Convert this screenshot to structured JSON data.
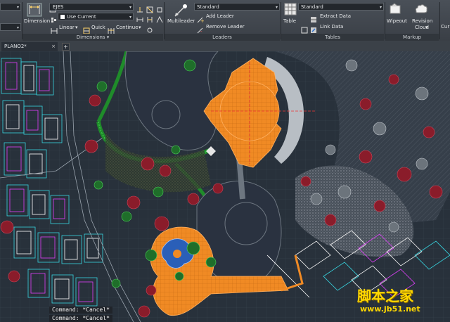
{
  "ribbon": {
    "dimension": {
      "label": "Dimension",
      "style_value": "EJES",
      "layer_value": "Use Current",
      "linear": "Linear",
      "quick": "Quick",
      "continue": "Continue",
      "panel_title": "Dimensions ▾"
    },
    "leaders": {
      "multileader": "Multileader",
      "style_value": "Standard",
      "add_leader": "Add Leader",
      "remove_leader": "Remove Leader",
      "panel_title": "Leaders"
    },
    "tables": {
      "table": "Table",
      "style_value": "Standard",
      "extract_data": "Extract Data",
      "link_data": "Link Data",
      "panel_title": "Tables"
    },
    "markup": {
      "wipeout": "Wipeout",
      "revision_cloud": "Revision\nCloud",
      "revision_cloud_line1": "Revision",
      "revision_cloud_line2": "Cloud",
      "panel_title": "Markup",
      "cur": "Cur"
    }
  },
  "document_tab": {
    "name": "PLANO2*",
    "close": "×",
    "new_tab": "+"
  },
  "command_history": [
    "Command: *Cancel*",
    "Command: *Cancel*"
  ],
  "watermark": {
    "title": "脚本之家",
    "url": "www.jb51.net"
  },
  "colors": {
    "ribbon_bg": "#3a3f46",
    "canvas_bg": "#27303a",
    "accent_orange": "#f08a24",
    "pool_blue": "#2a5fb8",
    "tree_red": "#8a1c2a",
    "hedge_green": "#1f8c2a",
    "building_cyan": "#37d5e0",
    "watermark_yellow": "#ffd800"
  }
}
